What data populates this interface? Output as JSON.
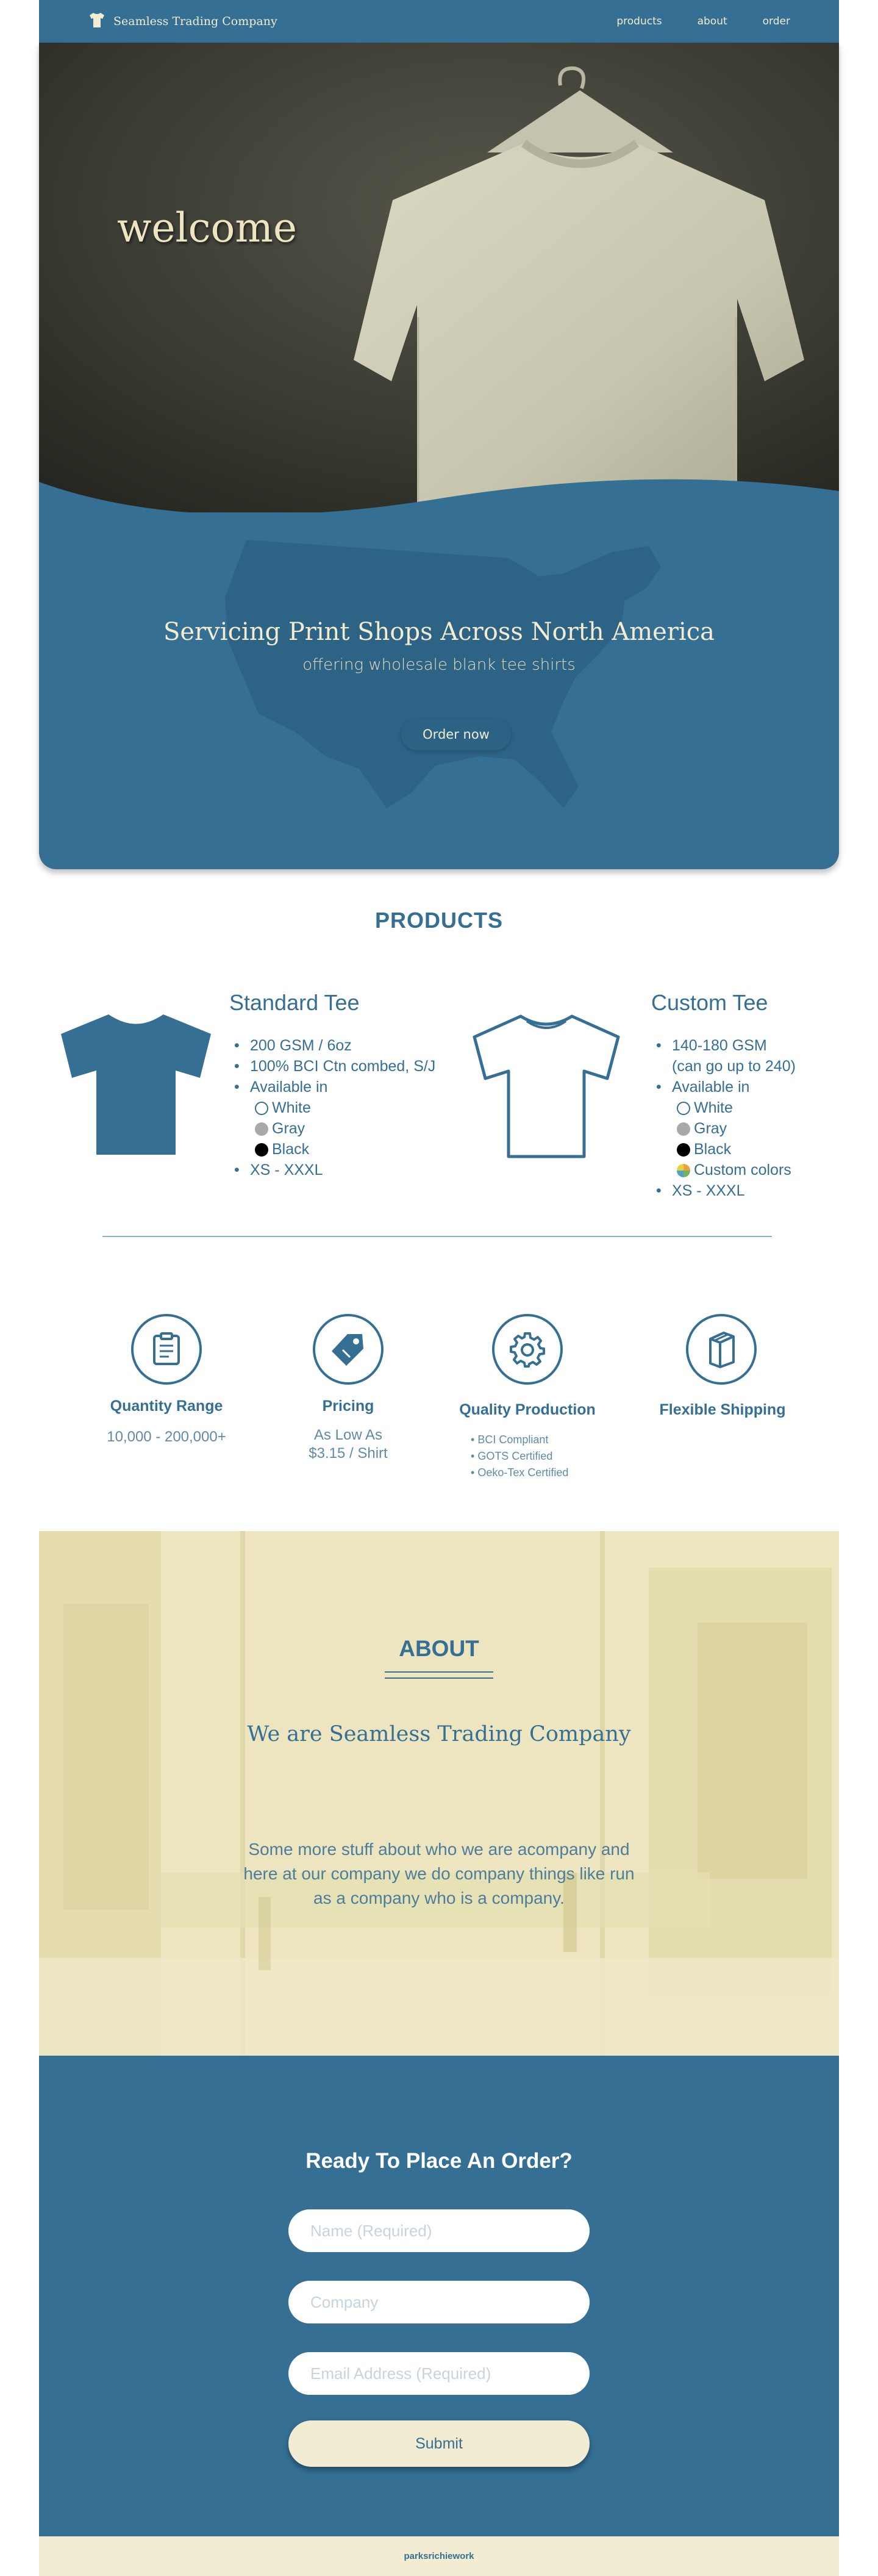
{
  "nav": {
    "brand": "Seamless Trading Company",
    "logo_icon": "tshirt-icon",
    "links": [
      "products",
      "about",
      "order"
    ]
  },
  "hero": {
    "welcome": "welcome",
    "title": "Servicing Print Shops Across North America",
    "subtitle": "offering wholesale blank tee shirts",
    "cta": "Order now"
  },
  "products": {
    "title": "PRODUCTS",
    "items": [
      {
        "name": "Standard Tee",
        "icon": "tshirt-filled-icon",
        "specs": [
          "200 GSM / 6oz",
          "100% BCI Ctn combed, S/J",
          "Available in"
        ],
        "colors": [
          {
            "label": "White",
            "hex": "#ffffff"
          },
          {
            "label": "Gray",
            "hex": "#a9a9a9"
          },
          {
            "label": "Black",
            "hex": "#000000"
          }
        ],
        "sizes": "XS - XXXL"
      },
      {
        "name": "Custom Tee",
        "icon": "tshirt-outline-icon",
        "specs": [
          "140-180 GSM",
          "(can go up to 240)",
          "Available in"
        ],
        "colors": [
          {
            "label": "White",
            "hex": "#ffffff"
          },
          {
            "label": "Gray",
            "hex": "#a9a9a9"
          },
          {
            "label": "Black",
            "hex": "#000000"
          },
          {
            "label": "Custom colors",
            "hex": "multicolor"
          }
        ],
        "sizes": "XS - XXXL"
      }
    ]
  },
  "features": [
    {
      "icon": "clipboard-icon",
      "title": "Quantity Range",
      "text": "10,000 - 200,000+"
    },
    {
      "icon": "price-tag-icon",
      "title": "Pricing",
      "line1": "As Low As",
      "line2": "$3.15 / Shirt"
    },
    {
      "icon": "gear-icon",
      "title": "Quality Production",
      "list": [
        "BCI Compliant",
        "GOTS Certified",
        "Oeko-Tex Certified"
      ]
    },
    {
      "icon": "box-icon",
      "title": "Flexible Shipping"
    }
  ],
  "about": {
    "title": "ABOUT",
    "heading": "We are Seamless Trading Company",
    "body": "Some more stuff about who we are acompany and here at our company we do company things like run as a company who is a company."
  },
  "contact": {
    "title": "Ready To Place An Order?",
    "fields": {
      "name": "Name (Required)",
      "company": "Company",
      "email": "Email Address (Required)"
    },
    "submit": "Submit"
  },
  "footer": {
    "text": "parksrichiework"
  },
  "colors": {
    "primary": "#356f94",
    "cream": "#f2ecd2",
    "divider": "#8fb1c7"
  }
}
